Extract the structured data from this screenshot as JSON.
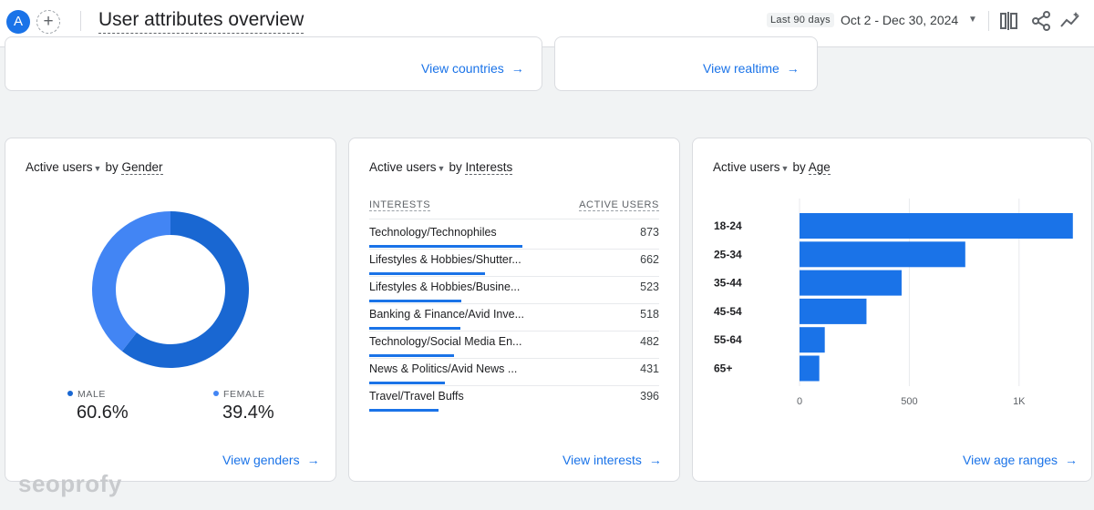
{
  "header": {
    "avatar_letter": "A",
    "add_symbol": "+",
    "title": "User attributes overview",
    "range_badge": "Last 90 days",
    "date_range": "Oct 2 - Dec 30, 2024",
    "caret": "▼",
    "icons": [
      "compare-icon",
      "share-icon",
      "insights-icon"
    ]
  },
  "top_cards": {
    "countries_link": "View countries",
    "realtime_link": "View realtime"
  },
  "gender_card": {
    "metric": "Active users",
    "by": "by",
    "dimension": "Gender",
    "legend": [
      {
        "label": "MALE",
        "value": "60.6%",
        "color": "#1967d2"
      },
      {
        "label": "FEMALE",
        "value": "39.4%",
        "color": "#4285f4"
      }
    ],
    "link": "View genders"
  },
  "interests_card": {
    "metric": "Active users",
    "by": "by",
    "dimension": "Interests",
    "col_interest": "INTERESTS",
    "col_users": "ACTIVE USERS",
    "rows": [
      {
        "label": "Technology/Technophiles",
        "value": "873",
        "n": 873
      },
      {
        "label": "Lifestyles & Hobbies/Shutter...",
        "value": "662",
        "n": 662
      },
      {
        "label": "Lifestyles & Hobbies/Busine...",
        "value": "523",
        "n": 523
      },
      {
        "label": "Banking & Finance/Avid Inve...",
        "value": "518",
        "n": 518
      },
      {
        "label": "Technology/Social Media En...",
        "value": "482",
        "n": 482
      },
      {
        "label": "News & Politics/Avid News ...",
        "value": "431",
        "n": 431
      },
      {
        "label": "Travel/Travel Buffs",
        "value": "396",
        "n": 396
      }
    ],
    "link": "View interests"
  },
  "age_card": {
    "metric": "Active users",
    "by": "by",
    "dimension": "Age",
    "link": "View age ranges"
  },
  "chart_data": [
    {
      "type": "pie",
      "title": "Active users by Gender",
      "categories": [
        "MALE",
        "FEMALE"
      ],
      "values": [
        60.6,
        39.4
      ],
      "colors": [
        "#1967d2",
        "#4285f4"
      ]
    },
    {
      "type": "bar",
      "orientation": "horizontal",
      "title": "Active users by Age",
      "categories": [
        "18-24",
        "25-34",
        "35-44",
        "45-54",
        "55-64",
        "65+"
      ],
      "values": [
        1245,
        755,
        465,
        305,
        115,
        90
      ],
      "xlim": [
        0,
        1250
      ],
      "xticks": [
        0,
        500,
        1000
      ],
      "xtick_labels": [
        "0",
        "500",
        "1K"
      ],
      "grid": true,
      "color": "#1a73e8"
    }
  ],
  "watermark": "seoprofy"
}
